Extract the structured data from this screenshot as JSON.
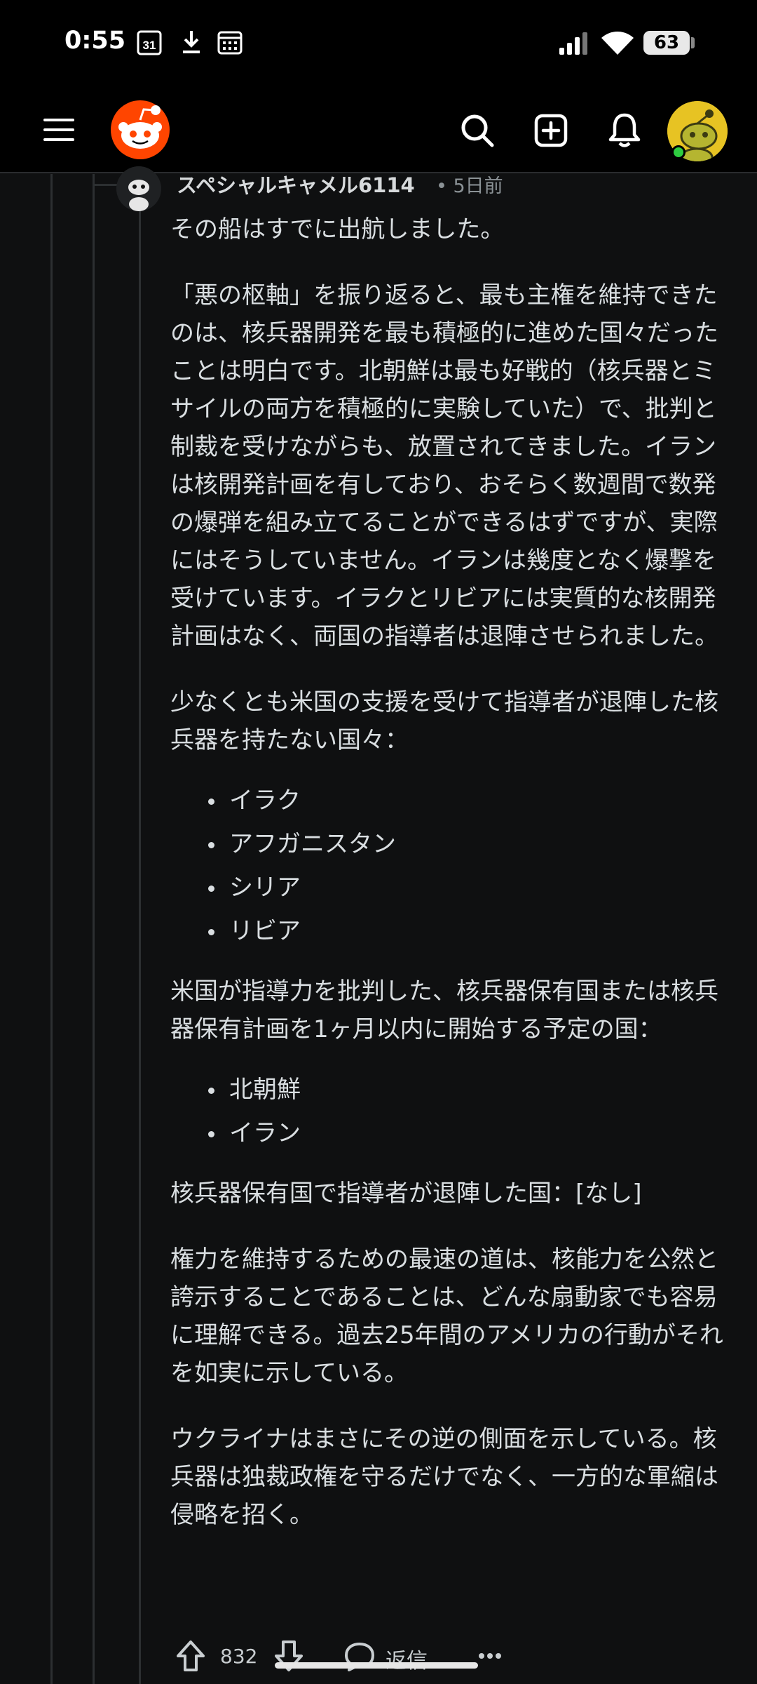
{
  "status_bar": {
    "time": "0:55",
    "calendar_day": "31",
    "battery": "63",
    "icons": [
      "calendar-icon",
      "download-icon",
      "calendar-grid-icon",
      "signal-icon",
      "wifi-icon",
      "battery-icon"
    ]
  },
  "app_bar": {
    "icons": [
      "menu-icon",
      "reddit-logo",
      "search-icon",
      "create-post-icon",
      "notifications-icon",
      "user-avatar"
    ]
  },
  "comment": {
    "author": "スペシャルキャメル6114",
    "age": "• 5日前",
    "paragraphs": [
      "その船はすでに出航しました。",
      "「悪の枢軸」を振り返ると、最も主権を維持できたのは、核兵器開発を最も積極的に進めた国々だったことは明白です。北朝鮮は最も好戦的（核兵器とミサイルの両方を積極的に実験していた）で、批判と制裁を受けながらも、放置されてきました。イランは核開発計画を有しており、おそらく数週間で数発の爆弾を組み立てることができるはずですが、実際にはそうしていません。イランは幾度となく爆撃を受けています。イラクとリビアには実質的な核開発計画はなく、両国の指導者は退陣させられました。",
      "少なくとも米国の支援を受けて指導者が退陣した核兵器を持たない国々：",
      "米国が指導力を批判した、核兵器保有国または核兵器保有計画を1ヶ月以内に開始する予定の国：",
      "核兵器保有国で指導者が退陣した国：[なし]",
      "権力を維持するための最速の道は、核能力を公然と誇示することであることは、どんな扇動家でも容易に理解できる。過去25年間のアメリカの行動がそれを如実に示している。",
      "ウクライナはまさにその逆の側面を示している。核兵器は独裁政権を守るだけでなく、一方的な軍縮は侵略を招く。"
    ],
    "list_1": [
      "イラク",
      "アフガニスタン",
      "シリア",
      "リビア"
    ],
    "list_2": [
      "北朝鮮",
      "イラン"
    ],
    "actions": {
      "vote_count": "832",
      "reply_label": "返信"
    }
  },
  "colors": {
    "background": "#0f1011",
    "reddit_orange": "#ff4500",
    "text": "#d9dee1",
    "muted": "#8b9296",
    "online": "#2ecc40"
  }
}
